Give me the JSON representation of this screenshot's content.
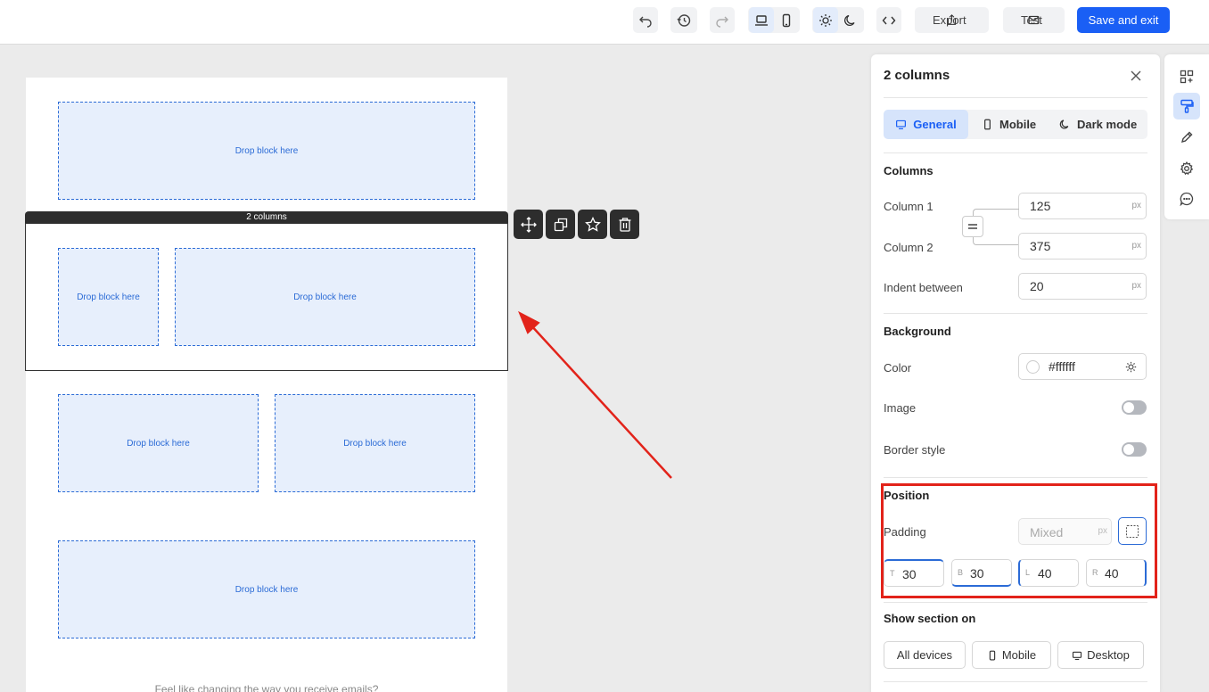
{
  "topbar": {
    "export_label": "Export",
    "test_label": "Test",
    "save_label": "Save and exit"
  },
  "canvas": {
    "drop_label": "Drop block here",
    "selected_label": "2 columns",
    "footer_text": "Feel like changing the way you receive emails?"
  },
  "panel": {
    "title": "2 columns",
    "tabs": [
      {
        "label": "General",
        "icon": "desktop-icon",
        "active": true
      },
      {
        "label": "Mobile",
        "icon": "mobile-icon",
        "active": false
      },
      {
        "label": "Dark mode",
        "icon": "moon-icon",
        "active": false
      }
    ],
    "columns": {
      "heading": "Columns",
      "column1_label": "Column 1",
      "column1_value": "125",
      "column2_label": "Column 2",
      "column2_value": "375",
      "indent_label": "Indent between",
      "indent_value": "20",
      "unit": "px"
    },
    "background": {
      "heading": "Background",
      "color_label": "Color",
      "color_value": "#ffffff",
      "image_label": "Image",
      "border_label": "Border style"
    },
    "position": {
      "heading": "Position",
      "padding_label": "Padding",
      "padding_placeholder": "Mixed",
      "unit": "px",
      "top_tag": "T",
      "top_value": "30",
      "bottom_tag": "B",
      "bottom_value": "30",
      "left_tag": "L",
      "left_value": "40",
      "right_tag": "R",
      "right_value": "40"
    },
    "show_section": {
      "heading": "Show section on",
      "all_label": "All devices",
      "mobile_label": "Mobile",
      "desktop_label": "Desktop"
    }
  },
  "colors": {
    "accent": "#1a5ff5",
    "highlight_box": "#e2231a",
    "drop_border": "#2b6bd6"
  }
}
